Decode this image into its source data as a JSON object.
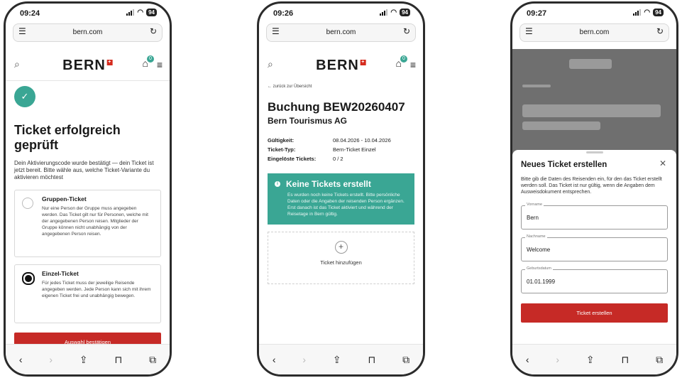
{
  "browser": {
    "host": "bern.com"
  },
  "status": [
    {
      "time": "09:24"
    },
    {
      "time": "09:26"
    },
    {
      "time": "09:27"
    }
  ],
  "battery": "94",
  "cart_count": "0",
  "logo": "BERN",
  "screen1": {
    "title": "Ticket erfolgreich geprüft",
    "intro": "Dein Aktivierungscode wurde bestätigt — dein Ticket ist jetzt bereit. Bitte wähle aus, welche Ticket-Variante du aktivieren möchtest",
    "options": [
      {
        "title": "Gruppen-Ticket",
        "desc": "Nur eine Person der Gruppe muss angegeben werden. Das Ticket gilt nur für Personen, welche mit der angegebenen Person reisen. Mitglieder der Gruppe können nicht unabhängig von der angegebenen Person reisen."
      },
      {
        "title": "Einzel-Ticket",
        "desc": "Für jedes Ticket muss der jeweilige Reisende angegeben werden. Jede Person kann sich mit ihrem eigenen Ticket frei und unabhängig bewegen."
      }
    ],
    "confirm_label": "Auswahl bestätigen"
  },
  "screen2": {
    "back_label": "zurück zur Übersicht",
    "title": "Buchung BEW20260407",
    "subtitle": "Bern Tourismus AG",
    "details": [
      {
        "key": "Gültigkeit:",
        "value": "08.04.2026 - 10.04.2026"
      },
      {
        "key": "Ticket-Typ:",
        "value": "Bern-Ticket Einzel"
      },
      {
        "key": "Eingelöste Tickets:",
        "value": "0 / 2"
      }
    ],
    "notice_title": "Keine Tickets erstellt",
    "notice_text": "Es wurden noch keine Tickets erstellt. Bitte persönliche Daten oder die Angaben der reisenden Person ergänzen. Erst danach ist das Ticket aktiviert und während der Reisetage in Bern gültig.",
    "add_label": "Ticket hinzufügen"
  },
  "screen3": {
    "sheet_title": "Neues Ticket erstellen",
    "sheet_desc": "Bitte gib die Daten des Reisenden ein, für den das Ticket erstellt werden soll. Das Ticket ist nur gültig, wenn die Angaben dem Ausweisdokument entsprechen.",
    "fields": [
      {
        "label": "Vorname",
        "value": "Bern"
      },
      {
        "label": "Nachname",
        "value": "Welcome"
      },
      {
        "label": "Geburtsdatum",
        "value": "01.01.1999"
      }
    ],
    "submit_label": "Ticket erstellen"
  }
}
